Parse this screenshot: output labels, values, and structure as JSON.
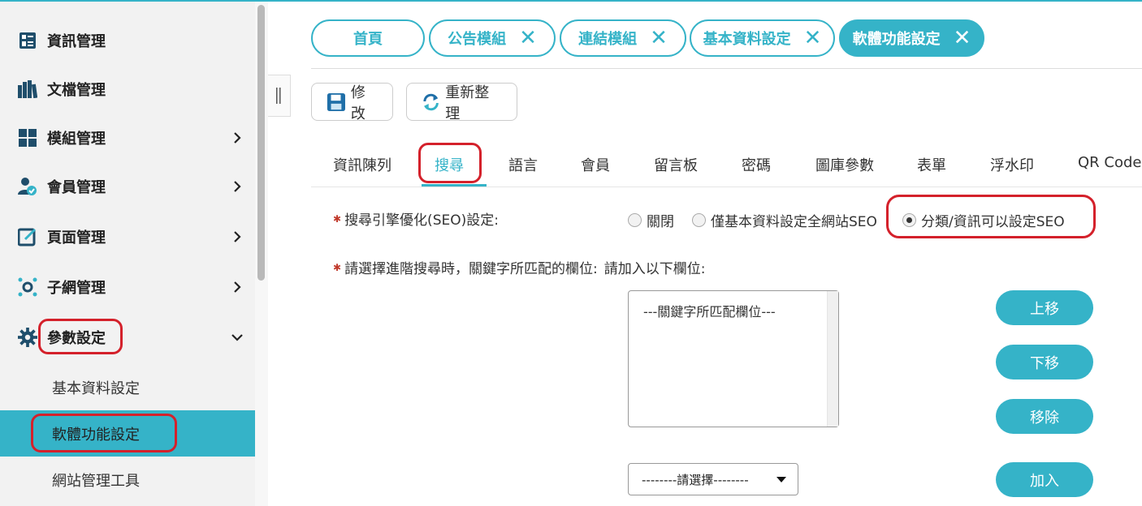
{
  "sidebar": {
    "items": [
      {
        "label": "資訊管理",
        "icon": "list-icon",
        "has_arrow": false
      },
      {
        "label": "文檔管理",
        "icon": "books-icon",
        "has_arrow": false
      },
      {
        "label": "模組管理",
        "icon": "grid-icon",
        "has_arrow": true
      },
      {
        "label": "會員管理",
        "icon": "user-check-icon",
        "has_arrow": true
      },
      {
        "label": "頁面管理",
        "icon": "edit-icon",
        "has_arrow": true
      },
      {
        "label": "子網管理",
        "icon": "network-icon",
        "has_arrow": true
      },
      {
        "label": "參數設定",
        "icon": "gear-icon",
        "has_arrow": true,
        "expanded": true
      }
    ],
    "subitems": [
      {
        "label": "基本資料設定",
        "active": false
      },
      {
        "label": "軟體功能設定",
        "active": true
      },
      {
        "label": "網站管理工具",
        "active": false
      }
    ]
  },
  "tabs": [
    {
      "label": "首頁",
      "closable": false
    },
    {
      "label": "公告模組",
      "closable": true
    },
    {
      "label": "連結模組",
      "closable": true
    },
    {
      "label": "基本資料設定",
      "closable": true
    },
    {
      "label": "軟體功能設定",
      "closable": true,
      "active": true
    }
  ],
  "tab_close_glyph": "✕",
  "toolbar": {
    "edit_label": "修改",
    "refresh_label": "重新整理"
  },
  "subtabs": [
    "資訊陳列",
    "搜尋",
    "語言",
    "會員",
    "留言板",
    "密碼",
    "圖庫參數",
    "表單",
    "浮水印",
    "QR Code"
  ],
  "subtab_active": "搜尋",
  "form": {
    "seo_label": "搜尋引擎優化(SEO)設定:",
    "seo_options": [
      {
        "label": "關閉",
        "checked": false
      },
      {
        "label": "僅基本資料設定全網站SEO",
        "checked": false
      },
      {
        "label": "分類/資訊可以設定SEO",
        "checked": true
      }
    ],
    "keyword_label": "請選擇進階搜尋時，關鍵字所匹配的欄位:",
    "keyword_hint": "請加入以下欄位:",
    "listbox_option": "---關鍵字所匹配欄位---",
    "select_value": "--------請選擇--------",
    "buttons": {
      "up": "上移",
      "down": "下移",
      "remove": "移除",
      "add": "加入"
    }
  },
  "colors": {
    "accent": "#35b3c8",
    "highlight_ring": "#d4212b",
    "icon_dark": "#1f4e6b"
  }
}
